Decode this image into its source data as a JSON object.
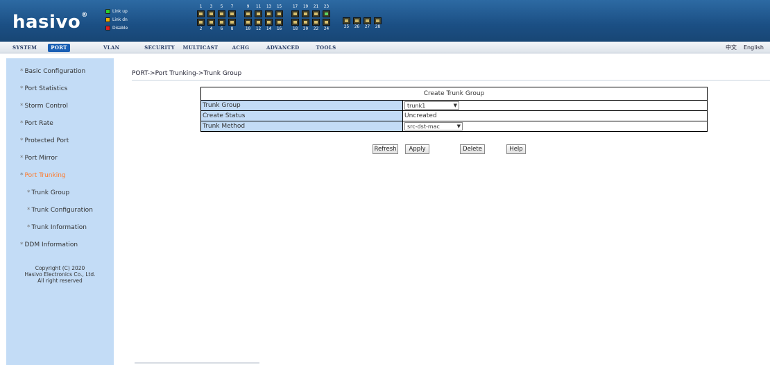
{
  "header": {
    "logo": "hasivo",
    "logo_mark": "®",
    "legend": [
      {
        "label": "Link up",
        "color": "green"
      },
      {
        "label": "Link dn",
        "color": "orange"
      },
      {
        "label": "Disable",
        "color": "red"
      }
    ],
    "ports_top": [
      "1",
      "3",
      "5",
      "7",
      "9",
      "11",
      "13",
      "15",
      "17",
      "19",
      "21",
      "23"
    ],
    "ports_bottom": [
      "2",
      "4",
      "6",
      "8",
      "10",
      "12",
      "14",
      "16",
      "18",
      "20",
      "22",
      "24"
    ],
    "sfp_ports": [
      "25",
      "26",
      "27",
      "28"
    ],
    "port_up": "23"
  },
  "nav": {
    "tabs": [
      "SYSTEM",
      "PORT",
      "VLAN",
      "SECURITY",
      "MULTICAST",
      "ACHG",
      "ADVANCED",
      "TOOLS"
    ],
    "active": "PORT",
    "lang_cn": "中文",
    "lang_en": "English"
  },
  "sidebar": {
    "items": [
      "Basic Configuration",
      "Port Statistics",
      "Storm Control",
      "Port Rate",
      "Protected Port",
      "Port Mirror",
      "Port Trunking",
      "Trunk Group",
      "Trunk Configuration",
      "Trunk Information",
      "DDM Information"
    ],
    "active": "Port Trunking",
    "copyright_1": "Copyright (C) 2020",
    "copyright_2": "Hasivo Electronics Co., Ltd.",
    "copyright_3": "All right reserved"
  },
  "main": {
    "breadcrumb": "PORT->Port Trunking->Trunk Group",
    "table_title": "Create Trunk Group",
    "rows": [
      {
        "label": "Trunk Group",
        "value": "trunk1",
        "type": "select"
      },
      {
        "label": "Create Status",
        "value": "Uncreated",
        "type": "text"
      },
      {
        "label": "Trunk Method",
        "value": "src-dst-mac",
        "type": "select"
      }
    ],
    "buttons": {
      "refresh": "Refresh",
      "apply": "Apply",
      "delete": "Delete",
      "help": "Help"
    }
  }
}
